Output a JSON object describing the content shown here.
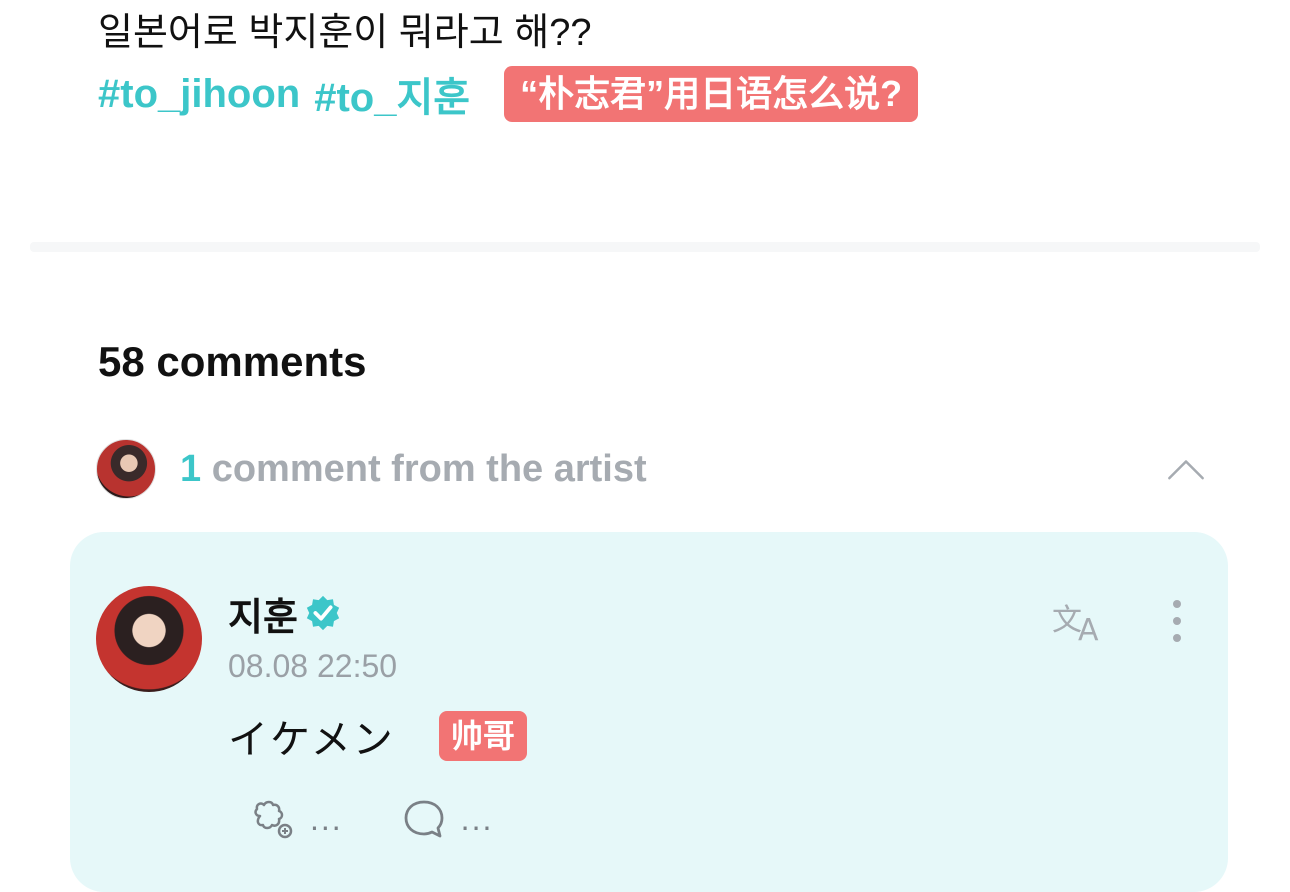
{
  "post": {
    "text": "일본어로 박지훈이 뭐라고 해??",
    "hashtags": [
      "#to_jihoon",
      "#to_지훈"
    ],
    "caption_badge": "“朴志君”用日语怎么说?"
  },
  "comments": {
    "count_label": "58 comments"
  },
  "artist_section": {
    "count": "1",
    "label": " comment from the artist"
  },
  "artist_comment": {
    "author": "지훈",
    "timestamp": "08.08 22:50",
    "text": "イケメン",
    "caption_badge": "帅哥",
    "reactions_count": "...",
    "replies_count": "..."
  },
  "icons": {
    "verified": "verified-badge-icon",
    "translate": "translate-icon",
    "more": "more-vertical-icon",
    "collapse": "chevron-up-icon",
    "reaction": "reaction-icon",
    "reply": "reply-bubble-icon"
  },
  "colors": {
    "accent": "#3cc6c9",
    "caption_badge": "#f27474",
    "artist_card_bg": "#e6f8f9",
    "muted_text": "#a6abb1"
  }
}
